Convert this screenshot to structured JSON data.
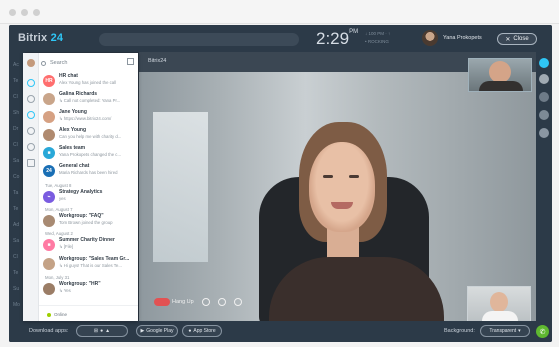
{
  "app": {
    "logo_name": "Bitrix",
    "logo_number": "24",
    "clock_time": "2:29",
    "clock_ampm": "PM",
    "meta_line1": "↓ 100 PM · ↑",
    "meta_line2": "• ROCKING",
    "user_name": "Yana Prokopets",
    "close_label": "Close"
  },
  "video": {
    "title": "Bitrix24",
    "hangup_label": "Hang Up"
  },
  "panel": {
    "search_placeholder": "Search",
    "footer_status": "Online",
    "chats": [
      {
        "name": "HR chat",
        "preview": "Alex Young has joined the call",
        "color": "#ff6e6e",
        "initials": "HR"
      },
      {
        "name": "Galina Richards",
        "preview": "↳ Call not completed: Yana Pr...",
        "color": "#c9a58a",
        "initials": ""
      },
      {
        "name": "Jane Young",
        "preview": "↳ https://www.bitrix24.com/",
        "color": "#d6a183",
        "initials": ""
      },
      {
        "name": "Alex Young",
        "preview": "Can you help me with charity d...",
        "color": "#b08a6f",
        "initials": ""
      },
      {
        "name": "Sales team",
        "preview": "Yana Prokopets changed the c...",
        "color": "#29a8d8",
        "initials": "■"
      },
      {
        "name": "General chat",
        "preview": "Maria Richards has been hired",
        "color": "#1a6fb5",
        "initials": "24"
      },
      {
        "name": "Strategy Analytics",
        "preview": "yes",
        "color": "#7a5ce0",
        "initials": "⌁"
      },
      {
        "name": "Workgroup: \"FAQ\"",
        "preview": "Tom Brown joined the group",
        "color": "#a88a72",
        "initials": ""
      },
      {
        "name": "Summer Charity Dinner",
        "preview": "↳ [File]",
        "color": "#ff7aa3",
        "initials": "■"
      },
      {
        "name": "Workgroup: \"Sales Team Gr...",
        "preview": "↳ Hi guys! That is our Sales Te...",
        "color": "#c4a286",
        "initials": ""
      },
      {
        "name": "Workgroup: \"HR\"",
        "preview": "↳ Yes",
        "color": "#9b7d66",
        "initials": ""
      }
    ],
    "date_separators": [
      "Tue, August 8",
      "Mon, August 7",
      "Wed, August 2",
      "Mon, July 31"
    ]
  },
  "bottombar": {
    "download_label": "Download apps:",
    "google_play_label": "Google Play",
    "app_store_label": "App Store",
    "background_label": "Background:",
    "background_value": "Transparent"
  },
  "left_strip_text": [
    "Ac",
    "Te",
    "Cl",
    "Sh",
    "Dr",
    "Cl",
    "Sa",
    "Co",
    "Ta",
    "Te",
    "Ad",
    "Sa",
    "Cl",
    "Te",
    "Su",
    "Mo"
  ],
  "colors": {
    "accent": "#2fc6f6",
    "hangup": "#e25253",
    "online": "#9dcf00",
    "phone": "#5fb830"
  }
}
